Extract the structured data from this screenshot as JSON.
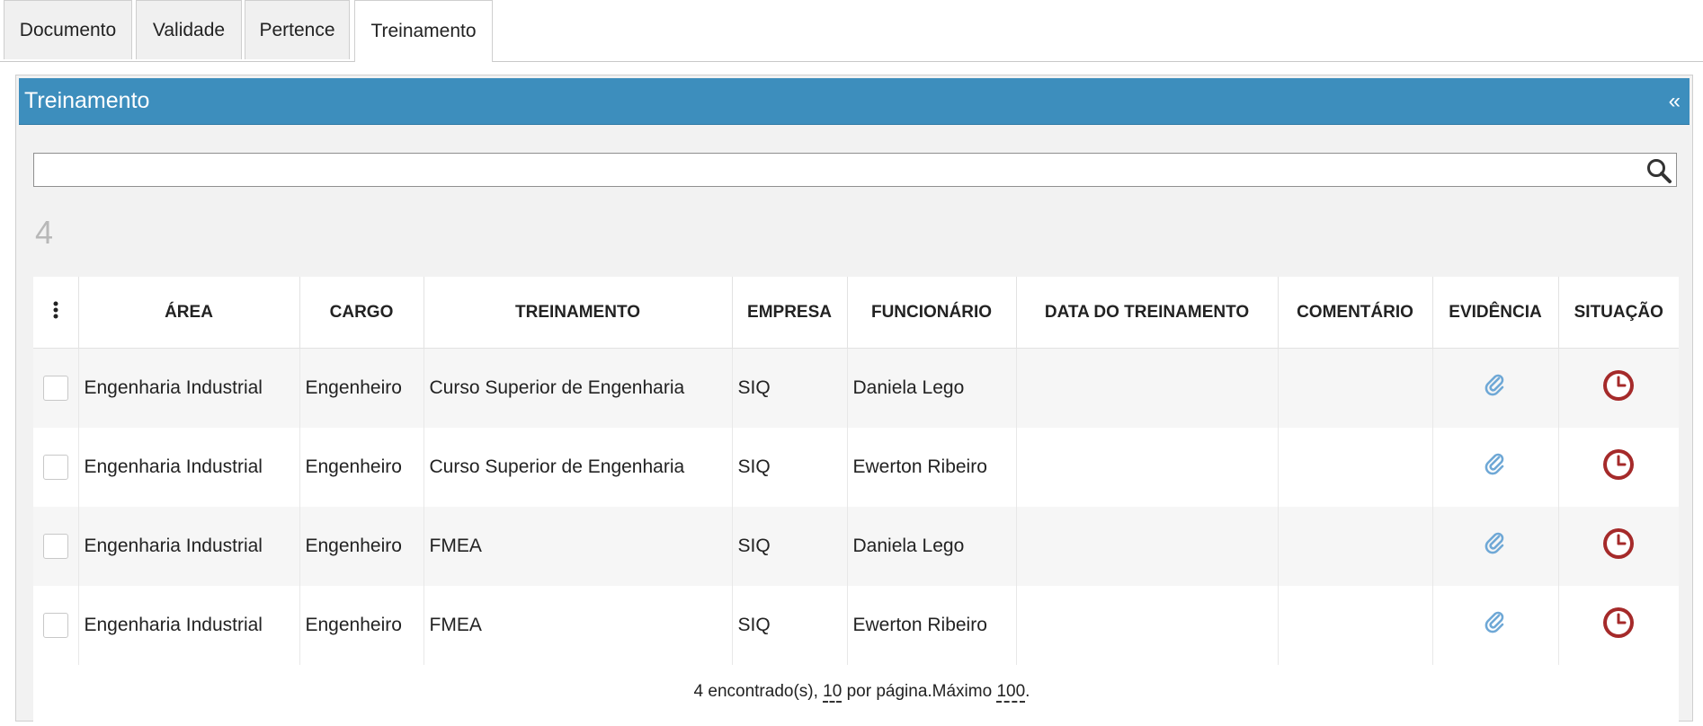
{
  "tabs": [
    {
      "label": "Documento",
      "active": false
    },
    {
      "label": "Validade",
      "active": false
    },
    {
      "label": "Pertence",
      "active": false
    },
    {
      "label": "Treinamento",
      "active": true
    }
  ],
  "panel": {
    "title": "Treinamento",
    "collapse_symbol": "«"
  },
  "search": {
    "value": "",
    "placeholder": "",
    "icon": "search-icon"
  },
  "result_count": "4",
  "table": {
    "columns": [
      "ÁREA",
      "CARGO",
      "TREINAMENTO",
      "EMPRESA",
      "FUNCIONÁRIO",
      "DATA DO TREINAMENTO",
      "COMENTÁRIO",
      "EVIDÊNCIA",
      "SITUAÇÃO"
    ],
    "menu_icon": "vertical-dots-icon",
    "rows": [
      {
        "area": "Engenharia Industrial",
        "cargo": "Engenheiro",
        "treinamento": "Curso Superior de Engenharia",
        "empresa": "SIQ",
        "funcionario": "Daniela Lego",
        "data": "",
        "comentario": "",
        "evidencia": "paperclip-icon",
        "situacao": "clock-icon"
      },
      {
        "area": "Engenharia Industrial",
        "cargo": "Engenheiro",
        "treinamento": "Curso Superior de Engenharia",
        "empresa": "SIQ",
        "funcionario": "Ewerton Ribeiro",
        "data": "",
        "comentario": "",
        "evidencia": "paperclip-icon",
        "situacao": "clock-icon"
      },
      {
        "area": "Engenharia Industrial",
        "cargo": "Engenheiro",
        "treinamento": "FMEA",
        "empresa": "SIQ",
        "funcionario": "Daniela Lego",
        "data": "",
        "comentario": "",
        "evidencia": "paperclip-icon",
        "situacao": "clock-icon"
      },
      {
        "area": "Engenharia Industrial",
        "cargo": "Engenheiro",
        "treinamento": "FMEA",
        "empresa": "SIQ",
        "funcionario": "Ewerton Ribeiro",
        "data": "",
        "comentario": "",
        "evidencia": "paperclip-icon",
        "situacao": "clock-icon"
      }
    ]
  },
  "footer": {
    "found_text": "4 encontrado(s), ",
    "per_page_value": "10",
    "per_page_text": " por página.Máximo ",
    "max_value": "100",
    "end_text": "."
  },
  "colors": {
    "header_blue": "#3d8ebd",
    "clock_red": "#a52a2a",
    "clip_blue": "#6fa8d6"
  }
}
